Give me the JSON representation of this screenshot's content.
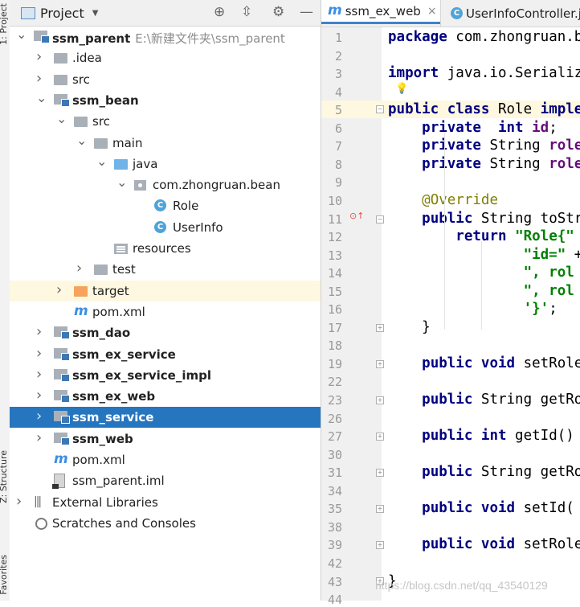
{
  "side_stripe": {
    "top_label": "1: Project",
    "mid_label": "Z: Structure",
    "bottom_label": "Favorites"
  },
  "project_panel": {
    "title": "Project"
  },
  "tree": [
    {
      "label": "ssm_parent",
      "path": "E:\\新建文件夹\\ssm_parent",
      "bold": true,
      "icon": "module-icon",
      "arrow": "expanded",
      "depth": 0
    },
    {
      "label": ".idea",
      "icon": "folder-icon",
      "arrow": "collapsed",
      "depth": 1
    },
    {
      "label": "src",
      "icon": "folder-icon",
      "arrow": "collapsed",
      "depth": 1
    },
    {
      "label": "ssm_bean",
      "bold": true,
      "icon": "module-icon",
      "arrow": "expanded",
      "depth": 1
    },
    {
      "label": "src",
      "icon": "folder-icon",
      "arrow": "expanded",
      "depth": 2
    },
    {
      "label": "main",
      "icon": "folder-icon",
      "arrow": "expanded",
      "depth": 3
    },
    {
      "label": "java",
      "icon": "source-folder-icon",
      "arrow": "expanded",
      "depth": 4
    },
    {
      "label": "com.zhongruan.bean",
      "icon": "package-icon",
      "arrow": "expanded",
      "depth": 5
    },
    {
      "label": "Role",
      "icon": "class-icon",
      "arrow": "none",
      "depth": 6
    },
    {
      "label": "UserInfo",
      "icon": "class-icon",
      "arrow": "none",
      "depth": 6
    },
    {
      "label": "resources",
      "icon": "resources-folder-icon",
      "arrow": "none",
      "depth": 4
    },
    {
      "label": "test",
      "icon": "folder-icon",
      "arrow": "collapsed",
      "depth": 3
    },
    {
      "label": "target",
      "icon": "excluded-folder-icon",
      "arrow": "collapsed",
      "depth": 2,
      "highlight": "target"
    },
    {
      "label": "pom.xml",
      "icon": "maven-icon",
      "arrow": "none",
      "depth": 2
    },
    {
      "label": "ssm_dao",
      "bold": true,
      "icon": "module-icon",
      "arrow": "collapsed",
      "depth": 1
    },
    {
      "label": "ssm_ex_service",
      "bold": true,
      "icon": "module-icon",
      "arrow": "collapsed",
      "depth": 1
    },
    {
      "label": "ssm_ex_service_impl",
      "bold": true,
      "icon": "module-icon",
      "arrow": "collapsed",
      "depth": 1
    },
    {
      "label": "ssm_ex_web",
      "bold": true,
      "icon": "module-icon",
      "arrow": "collapsed",
      "depth": 1
    },
    {
      "label": "ssm_service",
      "bold": true,
      "icon": "module-icon",
      "arrow": "collapsed",
      "depth": 1,
      "highlight": "selected"
    },
    {
      "label": "ssm_web",
      "bold": true,
      "icon": "module-icon",
      "arrow": "collapsed",
      "depth": 1
    },
    {
      "label": "pom.xml",
      "icon": "maven-icon",
      "arrow": "none",
      "depth": 1
    },
    {
      "label": "ssm_parent.iml",
      "icon": "iml-file-icon",
      "arrow": "none",
      "depth": 1
    },
    {
      "label": "External Libraries",
      "icon": "libraries-icon",
      "arrow": "collapsed",
      "depth": 0
    },
    {
      "label": "Scratches and Consoles",
      "icon": "scratches-icon",
      "arrow": "none",
      "depth": 0
    }
  ],
  "editor_tabs": [
    {
      "label": "ssm_ex_web",
      "icon": "maven-icon",
      "active": true,
      "close": "×"
    },
    {
      "label": "UserInfoController.ja",
      "icon": "class-icon",
      "active": false
    }
  ],
  "code_lines": [
    {
      "num": "1",
      "html": "<span class=\"kw\">package</span> com.zhongruan.b"
    },
    {
      "num": "2",
      "html": ""
    },
    {
      "num": "3",
      "html": "<span class=\"kw\">import</span> java.io.Serializ"
    },
    {
      "num": "4",
      "html": ""
    },
    {
      "num": "5",
      "html": "<span class=\"kw\">public class</span> Role <span class=\"kw\">implem</span>"
    },
    {
      "num": "6",
      "html": "    <span class=\"kw\">private  int</span> <span class=\"fld\">id</span>;"
    },
    {
      "num": "7",
      "html": "    <span class=\"kw\">private</span> String <span class=\"fld\">role</span>"
    },
    {
      "num": "8",
      "html": "    <span class=\"kw\">private</span> String <span class=\"fld\">role</span>"
    },
    {
      "num": "9",
      "html": ""
    },
    {
      "num": "10",
      "html": "    <span class=\"ann\">@Override</span>"
    },
    {
      "num": "11",
      "html": "    <span class=\"kw\">public</span> String toStr"
    },
    {
      "num": "12",
      "html": "        <span class=\"kw\">return</span> <span class=\"str\">\"Role{\"</span>"
    },
    {
      "num": "13",
      "html": "                <span class=\"str\">\"id=\"</span> +"
    },
    {
      "num": "14",
      "html": "                <span class=\"str\">\", rol</span>"
    },
    {
      "num": "15",
      "html": "                <span class=\"str\">\", rol</span>"
    },
    {
      "num": "16",
      "html": "                <span class=\"str\">'}'</span>;"
    },
    {
      "num": "17",
      "html": "    }"
    },
    {
      "num": "18",
      "html": ""
    },
    {
      "num": "19",
      "html": "    <span class=\"kw\">public void</span> setRole"
    },
    {
      "num": "22",
      "html": ""
    },
    {
      "num": "23",
      "html": "    <span class=\"kw\">public</span> String getRo"
    },
    {
      "num": "26",
      "html": ""
    },
    {
      "num": "27",
      "html": "    <span class=\"kw\">public int</span> getId() "
    },
    {
      "num": "30",
      "html": ""
    },
    {
      "num": "31",
      "html": "    <span class=\"kw\">public</span> String getRo"
    },
    {
      "num": "34",
      "html": ""
    },
    {
      "num": "35",
      "html": "    <span class=\"kw\">public void</span> setId("
    },
    {
      "num": "38",
      "html": ""
    },
    {
      "num": "39",
      "html": "    <span class=\"kw\">public void</span> setRole"
    },
    {
      "num": "42",
      "html": ""
    },
    {
      "num": "43",
      "html": "}"
    },
    {
      "num": "44",
      "html": ""
    }
  ],
  "watermark": "https://blog.csdn.net/qq_43540129"
}
